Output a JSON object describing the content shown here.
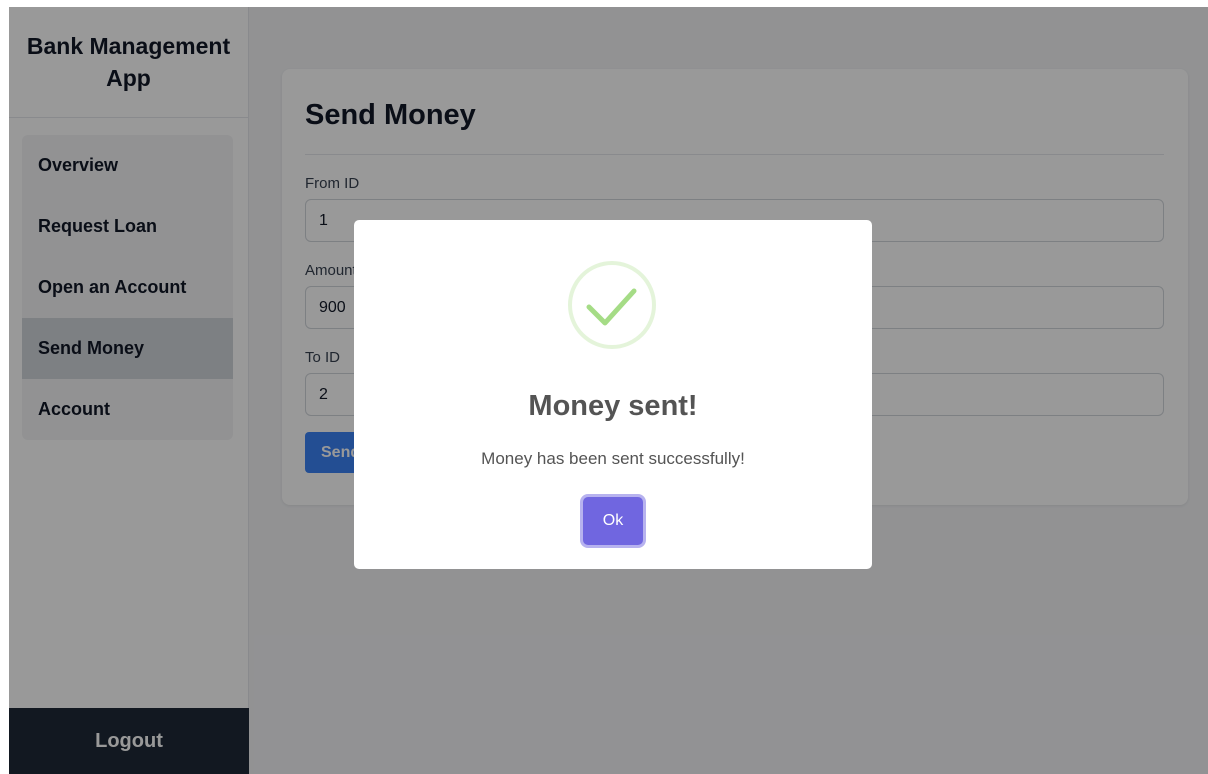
{
  "sidebar": {
    "brand": "Bank Management App",
    "items": [
      {
        "label": "Overview",
        "active": false
      },
      {
        "label": "Request Loan",
        "active": false
      },
      {
        "label": "Open an Account",
        "active": false
      },
      {
        "label": "Send Money",
        "active": true
      },
      {
        "label": "Account",
        "active": false
      }
    ],
    "logout_label": "Logout"
  },
  "form": {
    "title": "Send Money",
    "fields": [
      {
        "label": "From ID",
        "value": "1"
      },
      {
        "label": "Amount",
        "value": "900"
      },
      {
        "label": "To ID",
        "value": "2"
      }
    ],
    "submit_label": "Send"
  },
  "modal": {
    "icon": "check-circle-icon",
    "title": "Money sent!",
    "text": "Money has been sent successfully!",
    "ok_label": "Ok"
  },
  "colors": {
    "success": "#a5dc86",
    "confirm_button": "#7066e0",
    "primary_button": "#3b82f6",
    "logout_bg": "#1f2937"
  }
}
